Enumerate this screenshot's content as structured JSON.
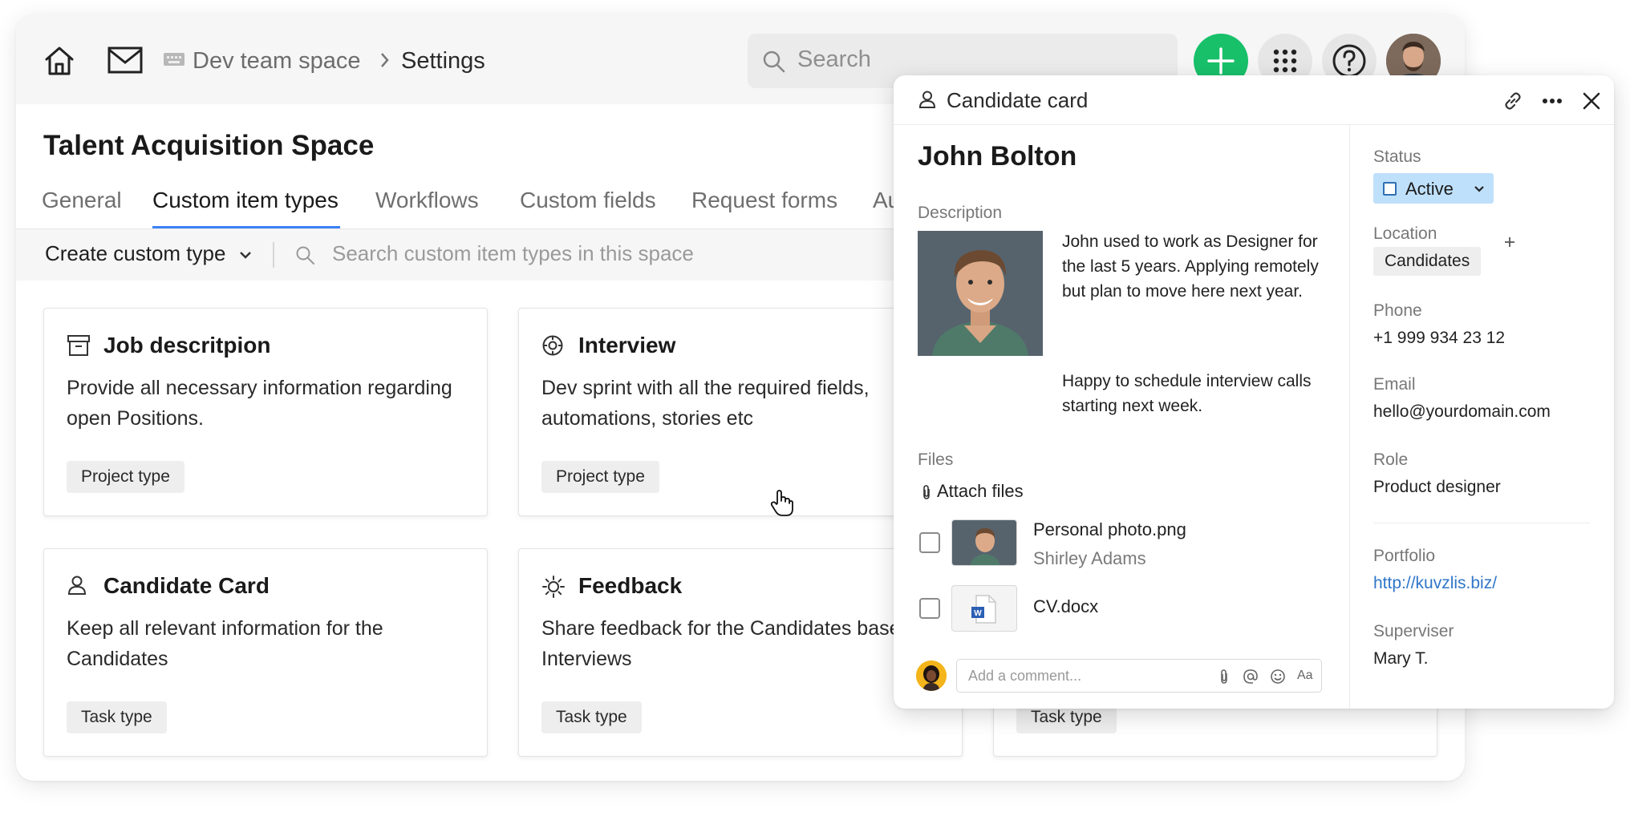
{
  "header": {
    "breadcrumb": {
      "space": "Dev team space",
      "current": "Settings"
    },
    "search_placeholder": "Search"
  },
  "page": {
    "title": "Talent Acquisition Space",
    "tabs": [
      "General",
      "Custom item types",
      "Workflows",
      "Custom fields",
      "Request forms",
      "Au"
    ],
    "active_tab": "Custom item types"
  },
  "toolbar": {
    "create_label": "Create custom type",
    "search_placeholder": "Search custom item types in this space"
  },
  "cards": [
    {
      "title": "Job descritpion",
      "description": "Provide all necessary information regarding open Positions.",
      "tag": "Project type",
      "icon": "archive-icon"
    },
    {
      "title": "Interview",
      "description": "Dev sprint with all the required fields, automations, stories etc",
      "tag": "Project type",
      "icon": "target-icon"
    },
    {
      "title": "Candidate Card",
      "description": "Keep all relevant information for the Candidates",
      "tag": "Task type",
      "icon": "person-icon"
    },
    {
      "title": "Feedback",
      "description": "Share feedback for the Candidates base on Interviews",
      "tag": "Task type",
      "icon": "sun-icon"
    },
    {
      "tag": "Task type"
    }
  ],
  "candidate_card": {
    "header_title": "Candidate card",
    "name": "John Bolton",
    "description_label": "Description",
    "description_p1": "John used to work as Designer for the last 5 years. Applying remotely but plan to move here next year.",
    "description_p2": "Happy to schedule interview calls starting next week.",
    "files_label": "Files",
    "attach_label": "Attach files",
    "files": [
      {
        "name": "Personal photo.png",
        "owner": "Shirley Adams"
      },
      {
        "name": "CV.docx"
      }
    ],
    "comment_placeholder": "Add a comment...",
    "comment_format": "Aa",
    "fields": {
      "status_label": "Status",
      "status_value": "Active",
      "location_label": "Location",
      "location_value": "Candidates",
      "phone_label": "Phone",
      "phone_value": "+1 999 934 23 12",
      "email_label": "Email",
      "email_value": "hello@yourdomain.com",
      "role_label": "Role",
      "role_value": "Product designer",
      "portfolio_label": "Portfolio",
      "portfolio_value": "http://kuvzlis.biz/",
      "supervisor_label": "Superviser",
      "supervisor_value": "Mary T."
    }
  },
  "colors": {
    "accent_blue": "#3b82f6",
    "add_green": "#18c06a",
    "status_bg": "#bfe0fb",
    "link": "#2f76c9"
  }
}
